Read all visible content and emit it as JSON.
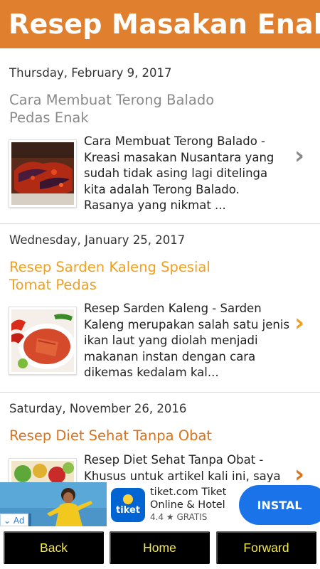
{
  "header": {
    "title": "Resep Masakan Enak"
  },
  "posts": [
    {
      "date": "Thursday, February 9, 2017",
      "title": "Cara Membuat Terong Balado Pedas Enak",
      "title_color": "#8a8a8a",
      "excerpt": "Cara Membuat Terong Balado - Kreasi masakan Nusantara yang sudah tidak asing lagi ditelinga kita adalah Terong Balado. Rasanya yang nikmat ...",
      "chevron": "›",
      "chevron_color": "#8a8a8a"
    },
    {
      "date": "Wednesday, January 25, 2017",
      "title": "Resep Sarden Kaleng Spesial Tomat Pedas",
      "title_color": "#f0a020",
      "excerpt": "Resep Sarden Kaleng - Sarden Kaleng merupakan salah satu jenis ikan laut yang diolah menjadi makanan instan dengan cara dikemas kedalam kal...",
      "chevron": "›",
      "chevron_color": "#f0a020"
    },
    {
      "date": "Saturday, November 26, 2016",
      "title": "Resep Diet Sehat Tanpa Obat",
      "title_color": "#d8731e",
      "excerpt": "Resep Diet Sehat Tanpa Obat - Khusus untuk artikel kali ini, saya",
      "chevron": "›",
      "chevron_color": "#d8731e"
    }
  ],
  "ad": {
    "label": "Ad",
    "logo_text": "tiket",
    "app_name": "tiket.com Tiket Online & Hotel",
    "rating": "4.4 ★ GRATIS",
    "install_label": "INSTAL"
  },
  "nav": {
    "back": "Back",
    "home": "Home",
    "forward": "Forward"
  },
  "colors": {
    "header_bg": "#e07f2e",
    "nav_text": "#f5e94a",
    "install_bg": "#1a73e8"
  }
}
